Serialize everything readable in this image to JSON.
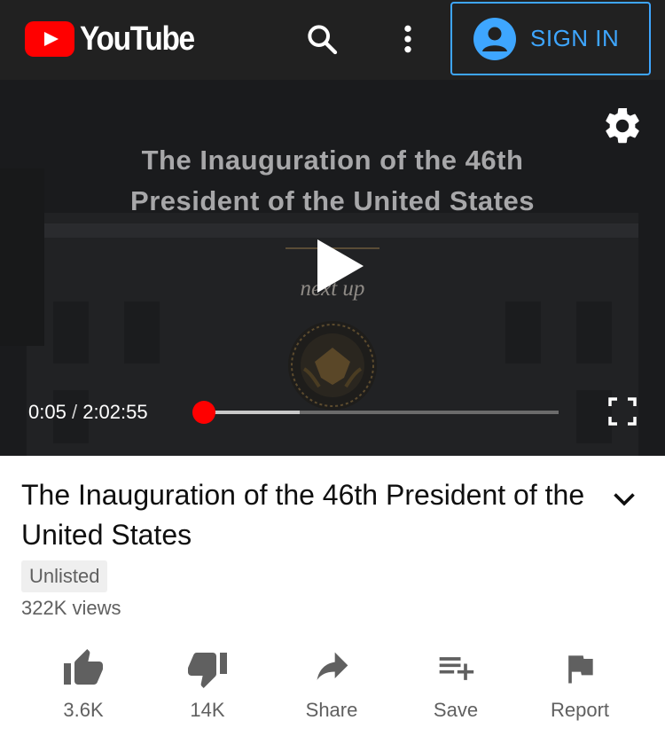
{
  "app": {
    "brand": "YouTube",
    "signin_label": "SIGN IN",
    "icons": {
      "search": "search-icon",
      "more": "more-vert-icon",
      "account": "account-circle-icon"
    }
  },
  "player": {
    "overlay_title_line1": "The Inauguration of the 46th",
    "overlay_title_line2": "President of the United States",
    "overlay_next_up": "next up",
    "current_time": "0:05",
    "separator": "/",
    "duration": "2:02:55",
    "progress_fraction": 0.0007,
    "buffered_fraction": 0.27,
    "colors": {
      "played": "#ff0000",
      "buffer": "#c8c8c8",
      "track": "#6b6b6b"
    }
  },
  "video": {
    "title": "The Inauguration of the 46th President of the United States",
    "privacy_badge": "Unlisted",
    "views": "322K views"
  },
  "actions": [
    {
      "id": "like",
      "label": "3.6K",
      "icon": "thumbs-up-icon"
    },
    {
      "id": "dislike",
      "label": "14K",
      "icon": "thumbs-down-icon"
    },
    {
      "id": "share",
      "label": "Share",
      "icon": "share-icon"
    },
    {
      "id": "save",
      "label": "Save",
      "icon": "playlist-add-icon"
    },
    {
      "id": "report",
      "label": "Report",
      "icon": "flag-icon"
    }
  ],
  "colors": {
    "accent": "#3ea6ff",
    "brand_red": "#ff0000",
    "header_bg": "#212121"
  }
}
